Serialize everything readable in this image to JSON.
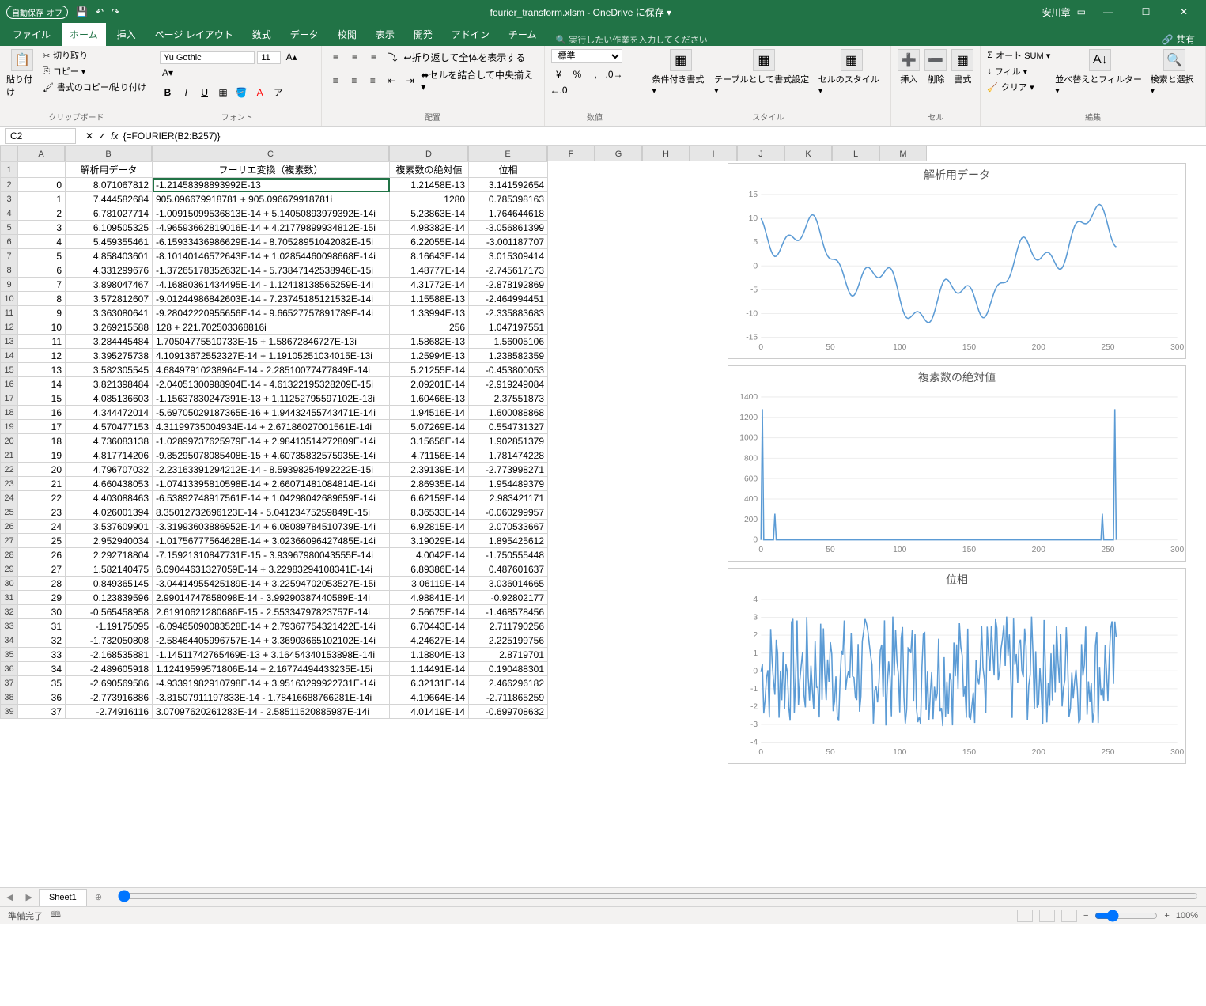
{
  "titlebar": {
    "autosave_label": "自動保存",
    "autosave_state": "オフ",
    "title": "fourier_transform.xlsm - OneDrive に保存 ▾",
    "user": "安川章"
  },
  "tabs": {
    "file": "ファイル",
    "home": "ホーム",
    "insert": "挿入",
    "pagelayout": "ページ レイアウト",
    "formulas": "数式",
    "data": "データ",
    "review": "校閲",
    "view": "表示",
    "developer": "開発",
    "addins": "アドイン",
    "team": "チーム",
    "tellme": "🔍 実行したい作業を入力してください",
    "share": "🔗 共有"
  },
  "ribbon": {
    "clipboard": {
      "paste": "貼り付け",
      "cut": "切り取り",
      "copy": "コピー ▾",
      "fmtpaint": "書式のコピー/貼り付け",
      "label": "クリップボード"
    },
    "font": {
      "name": "Yu Gothic",
      "size": "11",
      "label": "フォント"
    },
    "align": {
      "wrap": "折り返して全体を表示する",
      "merge": "セルを結合して中央揃え ▾",
      "label": "配置"
    },
    "number": {
      "style": "標準",
      "label": "数値"
    },
    "styles": {
      "cond": "条件付き書式 ▾",
      "tblf": "テーブルとして書式設定 ▾",
      "cellsty": "セルのスタイル ▾",
      "label": "スタイル"
    },
    "cells": {
      "insert": "挿入",
      "delete": "削除",
      "format": "書式",
      "label": "セル"
    },
    "editing": {
      "autosum": "オート SUM ▾",
      "fill": "フィル ▾",
      "clear": "クリア ▾",
      "sort": "並べ替えとフィルター ▾",
      "find": "検索と選択 ▾",
      "label": "編集"
    }
  },
  "namebox": "C2",
  "formula": "{=FOURIER(B2:B257)}",
  "columns": [
    "A",
    "B",
    "C",
    "D",
    "E",
    "F",
    "G",
    "H",
    "I",
    "J",
    "K",
    "L",
    "M"
  ],
  "headers": {
    "A": "",
    "B": "解析用データ",
    "C": "フーリエ変換（複素数）",
    "D": "複素数の絶対値",
    "E": "位相"
  },
  "rows": [
    {
      "n": "0",
      "b": "8.071067812",
      "c": "-1.21458398893992E-13",
      "d": "1.21458E-13",
      "e": "3.141592654"
    },
    {
      "n": "1",
      "b": "7.444582684",
      "c": "905.096679918781 +  905.096679918781i",
      "d": "1280",
      "e": "0.785398163"
    },
    {
      "n": "2",
      "b": "6.781027714",
      "c": "-1.00915099536813E-14 +  5.14050893979392E-14i",
      "d": "5.23863E-14",
      "e": "1.764644618"
    },
    {
      "n": "3",
      "b": "6.109505325",
      "c": "-4.96593662819016E-14 +  4.21779899934812E-15i",
      "d": "4.98382E-14",
      "e": "-3.056861399"
    },
    {
      "n": "4",
      "b": "5.459355461",
      "c": "-6.15933436986629E-14 -  8.70528951042082E-15i",
      "d": "6.22055E-14",
      "e": "-3.001187707"
    },
    {
      "n": "5",
      "b": "4.858403601",
      "c": "-8.10140146572643E-14 +  1.02854460098668E-14i",
      "d": "8.16643E-14",
      "e": "3.015309414"
    },
    {
      "n": "6",
      "b": "4.331299676",
      "c": "-1.37265178352632E-14 -  5.73847142538946E-15i",
      "d": "1.48777E-14",
      "e": "-2.745617173"
    },
    {
      "n": "7",
      "b": "3.898047467",
      "c": "-4.16880361434495E-14 -  1.12418138565259E-14i",
      "d": "4.31772E-14",
      "e": "-2.878192869"
    },
    {
      "n": "8",
      "b": "3.572812607",
      "c": "-9.01244986842603E-14 -  7.23745185121532E-14i",
      "d": "1.15588E-13",
      "e": "-2.464994451"
    },
    {
      "n": "9",
      "b": "3.363080641",
      "c": "-9.28042220955656E-14 -  9.66527757891789E-14i",
      "d": "1.33994E-13",
      "e": "-2.335883683"
    },
    {
      "n": "10",
      "b": "3.269215588",
      "c": "128 +  221.702503368816i",
      "d": "256",
      "e": "1.047197551"
    },
    {
      "n": "11",
      "b": "3.284445484",
      "c": "1.70504775510733E-15 +  1.58672846727E-13i",
      "d": "1.58682E-13",
      "e": "1.56005106"
    },
    {
      "n": "12",
      "b": "3.395275738",
      "c": "4.10913672552327E-14 +  1.19105251034015E-13i",
      "d": "1.25994E-13",
      "e": "1.238582359"
    },
    {
      "n": "13",
      "b": "3.582305545",
      "c": "4.68497910238964E-14 -  2.28510077477849E-14i",
      "d": "5.21255E-14",
      "e": "-0.453800053"
    },
    {
      "n": "14",
      "b": "3.821398484",
      "c": "-2.04051300988904E-14 -  4.61322195328209E-15i",
      "d": "2.09201E-14",
      "e": "-2.919249084"
    },
    {
      "n": "15",
      "b": "4.085136603",
      "c": "-1.15637830247391E-13 +  1.11252795597102E-13i",
      "d": "1.60466E-13",
      "e": "2.37551873"
    },
    {
      "n": "16",
      "b": "4.344472014",
      "c": "-5.69705029187365E-16 +  1.94432455743471E-14i",
      "d": "1.94516E-14",
      "e": "1.600088868"
    },
    {
      "n": "17",
      "b": "4.570477153",
      "c": "4.31199735004934E-14 +  2.67186027001561E-14i",
      "d": "5.07269E-14",
      "e": "0.554731327"
    },
    {
      "n": "18",
      "b": "4.736083138",
      "c": "-1.02899737625979E-14 +  2.98413514272809E-14i",
      "d": "3.15656E-14",
      "e": "1.902851379"
    },
    {
      "n": "19",
      "b": "4.817714206",
      "c": "-9.85295078085408E-15 +  4.60735832575935E-14i",
      "d": "4.71156E-14",
      "e": "1.781474228"
    },
    {
      "n": "20",
      "b": "4.796707032",
      "c": "-2.23163391294212E-14 -  8.59398254992222E-15i",
      "d": "2.39139E-14",
      "e": "-2.773998271"
    },
    {
      "n": "21",
      "b": "4.660438053",
      "c": "-1.07413395810598E-14 +  2.66071481084814E-14i",
      "d": "2.86935E-14",
      "e": "1.954489379"
    },
    {
      "n": "22",
      "b": "4.403088463",
      "c": "-6.53892748917561E-14 +  1.04298042689659E-14i",
      "d": "6.62159E-14",
      "e": "2.983421171"
    },
    {
      "n": "23",
      "b": "4.026001394",
      "c": "8.35012732696123E-14 -  5.04123475259849E-15i",
      "d": "8.36533E-14",
      "e": "-0.060299957"
    },
    {
      "n": "24",
      "b": "3.537609901",
      "c": "-3.31993603886952E-14 +  6.08089784510739E-14i",
      "d": "6.92815E-14",
      "e": "2.070533667"
    },
    {
      "n": "25",
      "b": "2.952940034",
      "c": "-1.01756777564628E-14 +  3.02366096427485E-14i",
      "d": "3.19029E-14",
      "e": "1.895425612"
    },
    {
      "n": "26",
      "b": "2.292718804",
      "c": "-7.15921310847731E-15 -  3.93967980043555E-14i",
      "d": "4.0042E-14",
      "e": "-1.750555448"
    },
    {
      "n": "27",
      "b": "1.582140475",
      "c": "6.09044631327059E-14 +  3.22983294108341E-14i",
      "d": "6.89386E-14",
      "e": "0.487601637"
    },
    {
      "n": "28",
      "b": "0.849365145",
      "c": "-3.04414955425189E-14 +  3.22594702053527E-15i",
      "d": "3.06119E-14",
      "e": "3.036014665"
    },
    {
      "n": "29",
      "b": "0.123839596",
      "c": "2.99014747858098E-14 -  3.99290387440589E-14i",
      "d": "4.98841E-14",
      "e": "-0.92802177"
    },
    {
      "n": "30",
      "b": "-0.565458958",
      "c": "2.61910621280686E-15 -  2.55334797823757E-14i",
      "d": "2.56675E-14",
      "e": "-1.468578456"
    },
    {
      "n": "31",
      "b": "-1.19175095",
      "c": "-6.09465090083528E-14 +  2.79367754321422E-14i",
      "d": "6.70443E-14",
      "e": "2.711790256"
    },
    {
      "n": "32",
      "b": "-1.732050808",
      "c": "-2.58464405996757E-14 +  3.36903665102102E-14i",
      "d": "4.24627E-14",
      "e": "2.225199756"
    },
    {
      "n": "33",
      "b": "-2.168535881",
      "c": "-1.14511742765469E-13 +  3.16454340153898E-14i",
      "d": "1.18804E-13",
      "e": "2.8719701"
    },
    {
      "n": "34",
      "b": "-2.489605918",
      "c": "1.12419599571806E-14 +  2.16774494433235E-15i",
      "d": "1.14491E-14",
      "e": "0.190488301"
    },
    {
      "n": "35",
      "b": "-2.690569586",
      "c": "-4.93391982910798E-14 +  3.95163299922731E-14i",
      "d": "6.32131E-14",
      "e": "2.466296182"
    },
    {
      "n": "36",
      "b": "-2.773916886",
      "c": "-3.81507911197833E-14 -  1.78416688766281E-14i",
      "d": "4.19664E-14",
      "e": "-2.711865259"
    },
    {
      "n": "37",
      "b": "-2.74916116",
      "c": "3.07097620261283E-14 -  2.58511520885987E-14i",
      "d": "4.01419E-14",
      "e": "-0.699708632"
    }
  ],
  "sheettab": "Sheet1",
  "statusbar": {
    "ready": "準備完了",
    "acc": "🕮",
    "zoom": "100%"
  },
  "chart_data": [
    {
      "type": "line",
      "title": "解析用データ",
      "x_ticks": [
        0,
        50,
        100,
        150,
        200,
        250,
        300
      ],
      "y_ticks": [
        -15,
        -10,
        -5,
        0,
        5,
        10,
        15
      ],
      "xlim": [
        0,
        300
      ],
      "ylim": [
        -15,
        15
      ],
      "note": "oscillating data, starts ~8, dips to ~-11 around x=90, rises to ~12 near x=230"
    },
    {
      "type": "line",
      "title": "複素数の絶対値",
      "x_ticks": [
        0,
        50,
        100,
        150,
        200,
        250,
        300
      ],
      "y_ticks": [
        0,
        200,
        400,
        600,
        800,
        1000,
        1200,
        1400
      ],
      "xlim": [
        0,
        300
      ],
      "ylim": [
        0,
        1400
      ],
      "peaks": [
        {
          "x": 1,
          "y": 1280
        },
        {
          "x": 10,
          "y": 256
        },
        {
          "x": 246,
          "y": 256
        },
        {
          "x": 255,
          "y": 1280
        }
      ]
    },
    {
      "type": "line",
      "title": "位相",
      "x_ticks": [
        0,
        50,
        100,
        150,
        200,
        250,
        300
      ],
      "y_ticks": [
        -4,
        -3,
        -2,
        -1,
        0,
        1,
        2,
        3,
        4
      ],
      "xlim": [
        0,
        300
      ],
      "ylim": [
        -4,
        4
      ],
      "note": "noisy phase angle oscillating between -π and π"
    }
  ]
}
